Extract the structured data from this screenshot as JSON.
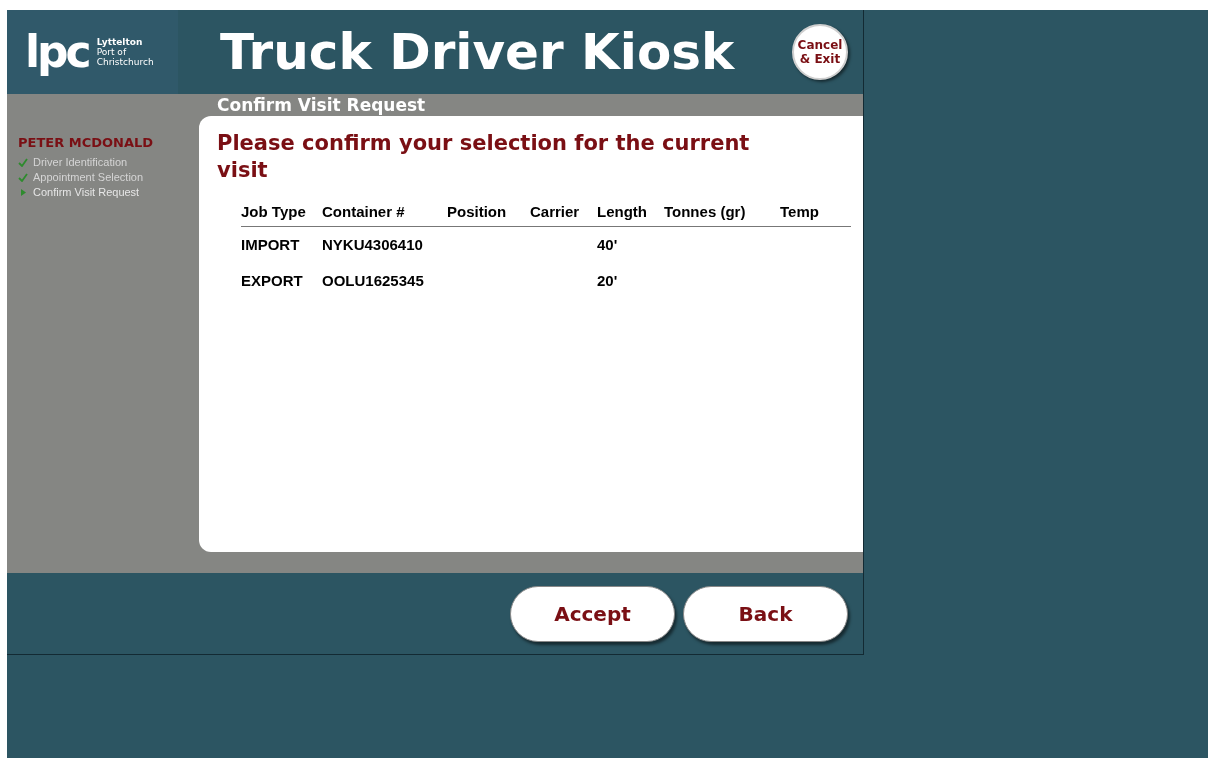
{
  "header": {
    "logo": {
      "mark": "lpc",
      "lines": [
        "Lyttelton",
        "Port of",
        "Christchurch"
      ]
    },
    "title": "Truck Driver Kiosk",
    "cancel_button": [
      "Cancel",
      "& Exit"
    ]
  },
  "sidebar": {
    "driver_name": "PETER MCDONALD",
    "steps": [
      {
        "label": "Driver Identification",
        "kind": "done"
      },
      {
        "label": "Appointment Selection",
        "kind": "done"
      },
      {
        "label": "Confirm Visit Request",
        "kind": "current"
      }
    ]
  },
  "page_title": "Confirm Visit Request",
  "card": {
    "heading": "Please confirm your selection for the current visit",
    "table": {
      "columns": [
        "Job Type",
        "Container #",
        "Position",
        "Carrier",
        "Length",
        "Tonnes (gr)",
        "Temp"
      ],
      "rows": [
        [
          "IMPORT",
          "NYKU4306410",
          "",
          "",
          "40'",
          "",
          ""
        ],
        [
          "EXPORT",
          "OOLU1625345",
          "",
          "",
          "20'",
          "",
          ""
        ]
      ]
    }
  },
  "buttons": [
    "Accept",
    "Back"
  ]
}
